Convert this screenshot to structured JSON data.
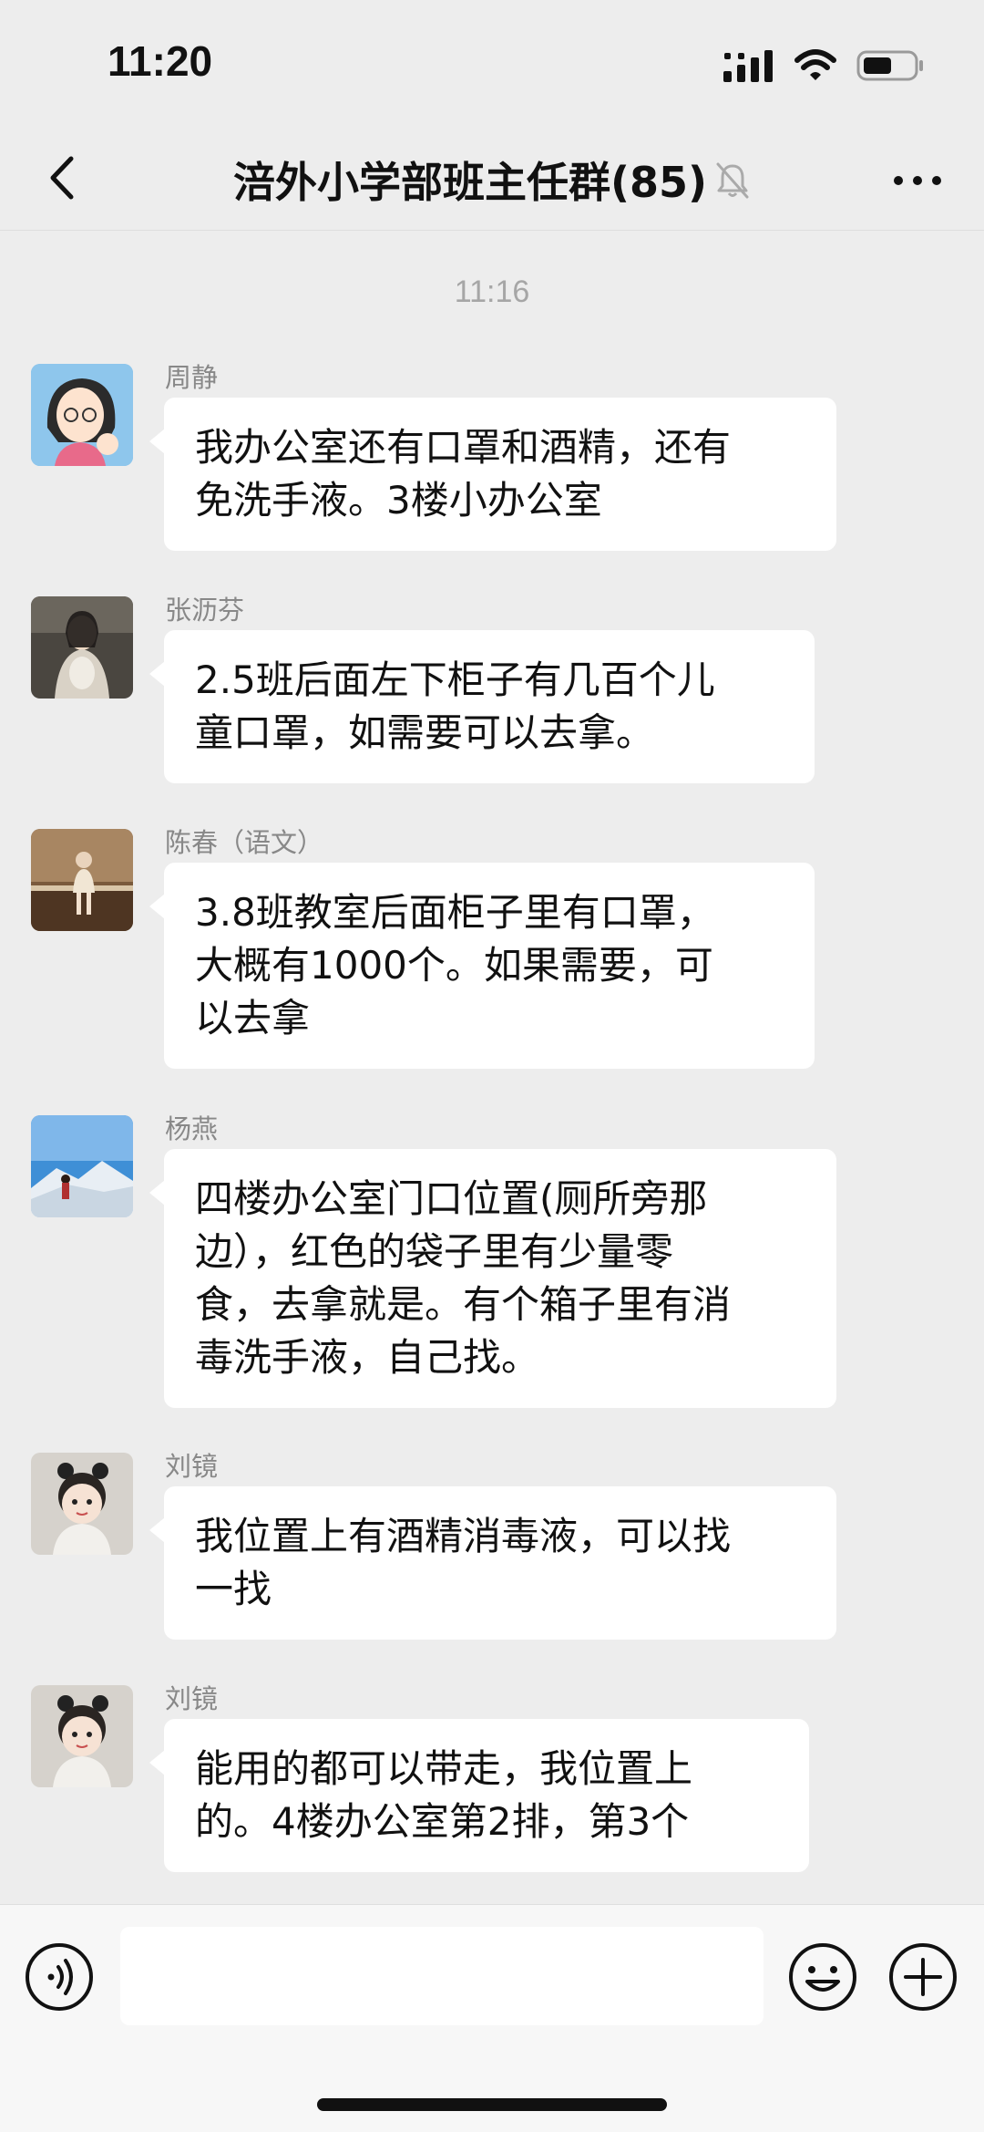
{
  "status_bar": {
    "time": "11:20"
  },
  "header": {
    "title": "涪外小学部班主任群(85)"
  },
  "chat": {
    "time_divider": "11:16",
    "messages": [
      {
        "sender": "周静",
        "lines": [
          "我办公室还有口罩和酒精，还有",
          "免洗手液。3楼小办公室"
        ]
      },
      {
        "sender": "张沥芬",
        "lines": [
          "2.5班后面左下柜子有几百个儿",
          "童口罩，如需要可以去拿。"
        ]
      },
      {
        "sender": "陈春（语文）",
        "lines": [
          "3.8班教室后面柜子里有口罩，",
          "大概有1000个。如果需要，可",
          "以去拿"
        ]
      },
      {
        "sender": "杨燕",
        "lines": [
          "四楼办公室门口位置(厕所旁那",
          "边），红色的袋子里有少量零",
          "食，去拿就是。有个箱子里有消",
          "毒洗手液，自己找。"
        ]
      },
      {
        "sender": "刘镜",
        "lines": [
          "我位置上有酒精消毒液，可以找",
          "一找"
        ]
      },
      {
        "sender": "刘镜",
        "lines": [
          "能用的都可以带走，我位置上",
          "的。4楼办公室第2排，第3个"
        ]
      }
    ]
  },
  "input_bar": {
    "placeholder": ""
  }
}
